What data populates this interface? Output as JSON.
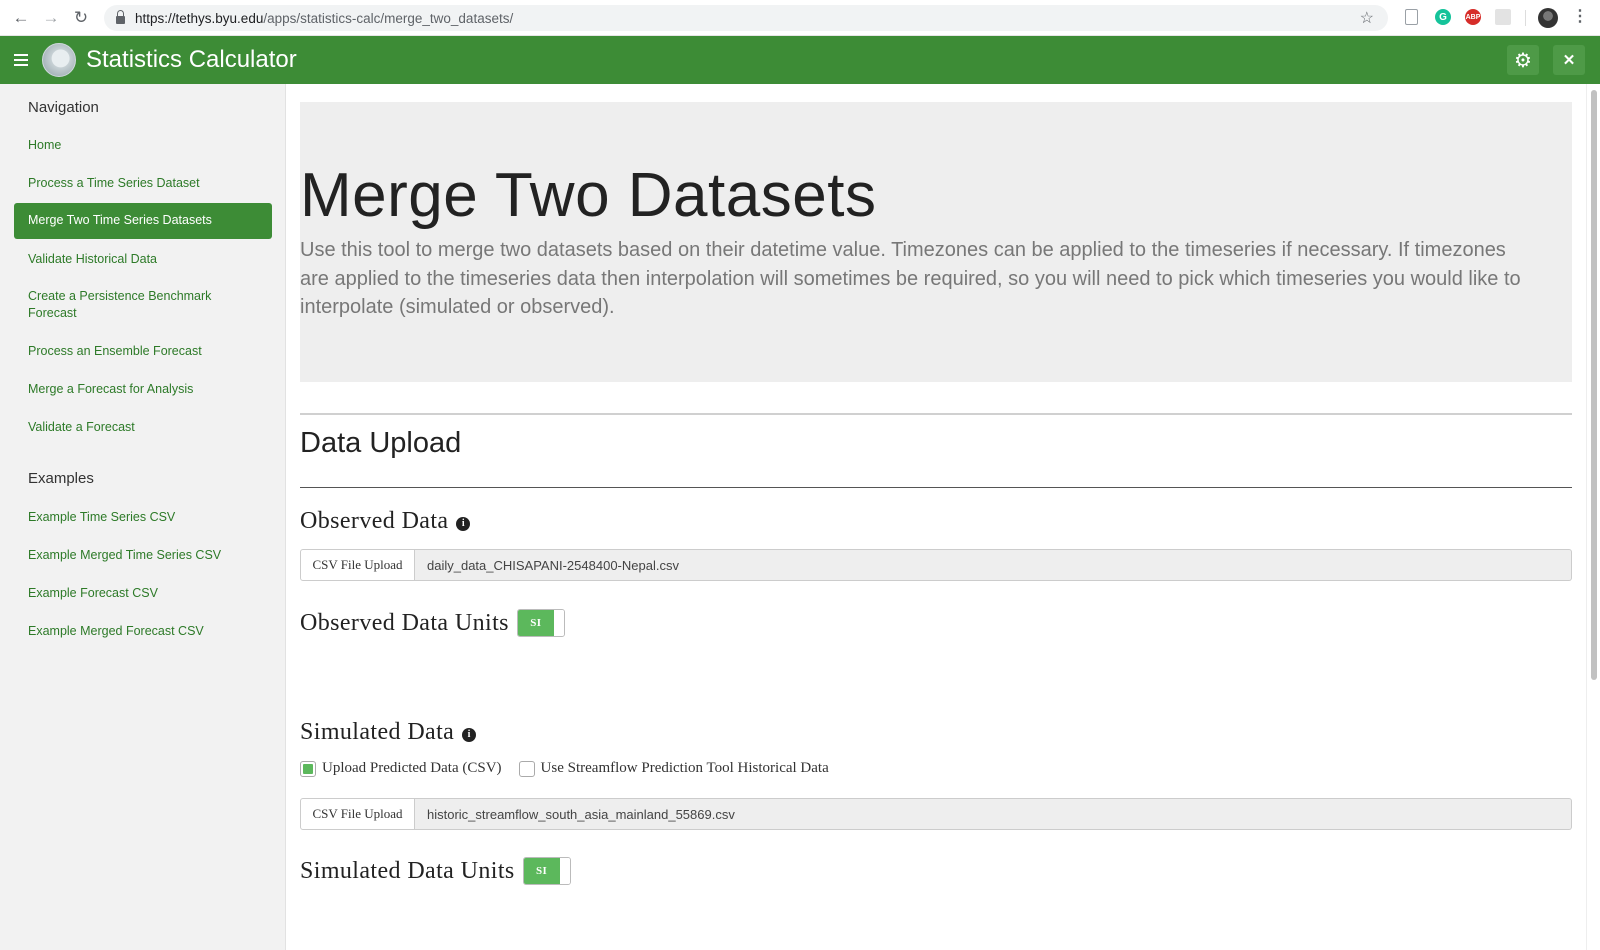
{
  "browser": {
    "url_host": "https://tethys.byu.edu",
    "url_path": "/apps/statistics-calc/merge_two_datasets/",
    "ext_abp": "ABP",
    "ext_g": "G"
  },
  "app": {
    "title": "Statistics Calculator"
  },
  "sidebar": {
    "nav_heading": "Navigation",
    "nav_items": [
      {
        "label": "Home"
      },
      {
        "label": "Process a Time Series Dataset"
      },
      {
        "label": "Merge Two Time Series Datasets"
      },
      {
        "label": "Validate Historical Data"
      },
      {
        "label": "Create a Persistence Benchmark Forecast"
      },
      {
        "label": "Process an Ensemble Forecast"
      },
      {
        "label": "Merge a Forecast for Analysis"
      },
      {
        "label": "Validate a Forecast"
      }
    ],
    "examples_heading": "Examples",
    "example_items": [
      {
        "label": "Example Time Series CSV"
      },
      {
        "label": "Example Merged Time Series CSV"
      },
      {
        "label": "Example Forecast CSV"
      },
      {
        "label": "Example Merged Forecast CSV"
      }
    ]
  },
  "main": {
    "page_title": "Merge Two Datasets",
    "description": "Use this tool to merge two datasets based on their datetime value. Timezones can be applied to the timeseries if necessary. If timezones are applied to the timeseries data then interpolation will sometimes be required, so you will need to pick which timeseries you would like to interpolate (simulated or observed).",
    "section_title": "Data Upload",
    "observed": {
      "label": "Observed Data",
      "file_button": "CSV File Upload",
      "file_name": "daily_data_CHISAPANI-2548400-Nepal.csv",
      "units_label": "Observed Data Units",
      "units_value": "SI"
    },
    "simulated": {
      "label": "Simulated Data",
      "option_upload": "Upload Predicted Data (CSV)",
      "option_upload_checked": true,
      "option_spt": "Use Streamflow Prediction Tool Historical Data",
      "option_spt_checked": false,
      "file_button": "CSV File Upload",
      "file_name": "historic_streamflow_south_asia_mainland_55869.csv",
      "units_label": "Simulated Data Units",
      "units_value": "SI"
    },
    "info_glyph": "i"
  },
  "colors": {
    "header_green": "#3d8c36",
    "link_green": "#2d7a28",
    "toggle_green": "#5cb85c",
    "jumbotron_gray": "#eeeeee"
  },
  "icons": {
    "back": "arrow-left-icon",
    "forward": "arrow-right-icon",
    "reload": "reload-icon",
    "settings": "gear-icon",
    "close": "close-icon",
    "menu": "hamburger-icon",
    "info": "info-icon"
  }
}
